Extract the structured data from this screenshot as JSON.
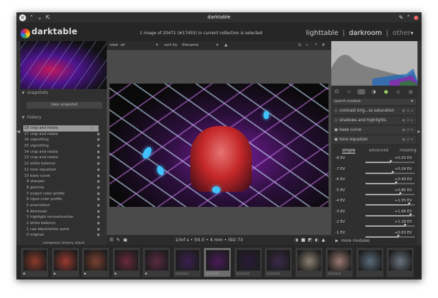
{
  "window": {
    "title": "darktable"
  },
  "header": {
    "logo": "darktable",
    "logo_sub": "",
    "collection_info": "1 image of 20471 (#17455) in current collection is selected",
    "views": [
      {
        "label": "lighttable"
      },
      {
        "label": "darkroom"
      },
      {
        "label": "other"
      }
    ],
    "separator": "|"
  },
  "left": {
    "snapshots": {
      "title": "snapshots",
      "button": "take snapshot"
    },
    "history": {
      "title": "history",
      "items": [
        {
          "num": "18",
          "label": "crop and rotate",
          "selected": true
        },
        {
          "num": "17",
          "label": "crop and rotate"
        },
        {
          "num": "16",
          "label": "vignetting"
        },
        {
          "num": "15",
          "label": "vignetting"
        },
        {
          "num": "14",
          "label": "crop and rotate"
        },
        {
          "num": "13",
          "label": "crop and rotate"
        },
        {
          "num": "12",
          "label": "white balance"
        },
        {
          "num": "11",
          "label": "tone equalizer"
        },
        {
          "num": "10",
          "label": "base curve"
        },
        {
          "num": "9",
          "label": "sharpen"
        },
        {
          "num": "8",
          "label": "gamma"
        },
        {
          "num": "7",
          "label": "output color profile"
        },
        {
          "num": "6",
          "label": "input color profile"
        },
        {
          "num": "5",
          "label": "orientation"
        },
        {
          "num": "4",
          "label": "demosaic"
        },
        {
          "num": "3",
          "label": "highlight reconstruction"
        },
        {
          "num": "2",
          "label": "white balance"
        },
        {
          "num": "1",
          "label": "raw black/white point"
        },
        {
          "num": "0",
          "label": "original"
        }
      ],
      "compress": "compress history stack"
    }
  },
  "toolbar": {
    "view_label": "view",
    "view_value": "all",
    "sort_label": "sort by",
    "sort_value": "filename"
  },
  "bottom_bar": {
    "info": "1/inf s • f/0.0 • 4 mm • ISO 73"
  },
  "right": {
    "search_placeholder": "search module",
    "modules": [
      {
        "label": "contrast brig...ss saturation"
      },
      {
        "label": "shadows and highlights"
      },
      {
        "label": "base curve"
      },
      {
        "label": "tone equalizer"
      }
    ],
    "tone_tabs": [
      "simple",
      "advanced",
      "masking"
    ],
    "ev_rows": [
      {
        "label": "-8 EV",
        "value": "+0.03 EV",
        "level": 0.51
      },
      {
        "label": "-7 EV",
        "value": "+0.24 EV",
        "level": 0.56
      },
      {
        "label": "-6 EV",
        "value": "+0.49 EV",
        "level": 0.62
      },
      {
        "label": "-5 EV",
        "value": "+0.85 EV",
        "level": 0.71
      },
      {
        "label": "-4 EV",
        "value": "+1.55 EV",
        "level": 0.89
      },
      {
        "label": "-3 EV",
        "value": "+1.66 EV",
        "level": 0.92
      },
      {
        "label": "-2 EV",
        "value": "+1.18 EV",
        "level": 0.8
      },
      {
        "label": "-1 EV",
        "value": "+0.63 EV",
        "level": 0.66
      }
    ],
    "more_modules": "more modules"
  },
  "filmstrip": {
    "thumbs": [
      {
        "stars": "★",
        "color": "#8a3a2a"
      },
      {
        "stars": "★",
        "color": "#9a3a30"
      },
      {
        "stars": "★",
        "color": "#7a4030"
      },
      {
        "stars": "★",
        "color": "#6a2a3a"
      },
      {
        "stars": "★",
        "color": "#5a2a40"
      },
      {
        "stars": "☆☆☆☆☆",
        "color": "#3a2050"
      },
      {
        "stars": "☆☆☆☆☆",
        "color": "#4a1a5a",
        "selected": true
      },
      {
        "stars": "☆☆☆☆☆",
        "color": "#2a1a3a"
      },
      {
        "stars": "☆☆☆☆☆",
        "color": "#3a2a4a"
      },
      {
        "stars": "",
        "color": "#8a8070"
      },
      {
        "stars": "☆☆☆☆☆",
        "color": "#9a7a70"
      },
      {
        "stars": "",
        "color": "#5a6a7a"
      },
      {
        "stars": "",
        "color": "#6a7480"
      }
    ]
  },
  "colors": {
    "accent": "#eeeeee",
    "panel": "#303030",
    "selected_history": "#9a9a9a"
  }
}
